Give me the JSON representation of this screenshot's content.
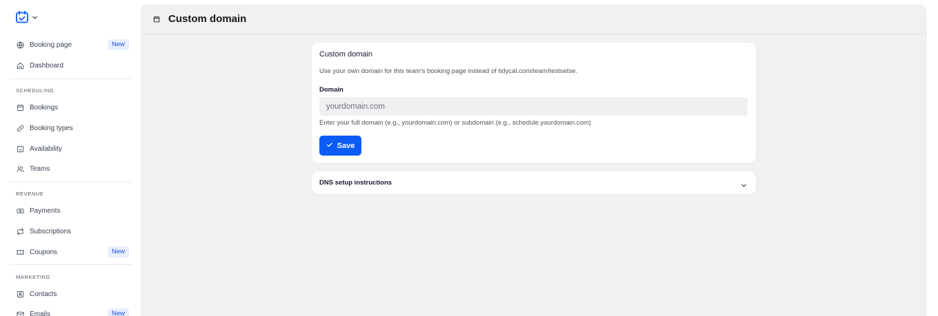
{
  "sidebar": {
    "logo_icon": "calendar-check-icon",
    "logo_chevron_icon": "chevron-down-icon",
    "items_top": [
      {
        "label": "Booking page",
        "icon": "globe-icon",
        "badge": "New"
      },
      {
        "label": "Dashboard",
        "icon": "home-icon"
      }
    ],
    "sections": [
      {
        "label": "SCHEDULING",
        "items": [
          {
            "label": "Bookings",
            "icon": "calendar-icon"
          },
          {
            "label": "Booking types",
            "icon": "link-icon"
          },
          {
            "label": "Availability",
            "icon": "calendar-check-icon"
          },
          {
            "label": "Teams",
            "icon": "users-icon"
          }
        ]
      },
      {
        "label": "REVENUE",
        "items": [
          {
            "label": "Payments",
            "icon": "banknote-icon"
          },
          {
            "label": "Subscriptions",
            "icon": "repeat-icon"
          },
          {
            "label": "Coupons",
            "icon": "ticket-icon",
            "badge": "New"
          }
        ]
      },
      {
        "label": "MARKETING",
        "items": [
          {
            "label": "Contacts",
            "icon": "contact-icon"
          },
          {
            "label": "Emails",
            "icon": "mail-icon",
            "badge": "New"
          }
        ]
      }
    ]
  },
  "header": {
    "icon": "calendar-icon",
    "title": "Custom domain"
  },
  "custom_domain_card": {
    "title": "Custom domain",
    "description": "Use your own domain for this team's booking page instead of tidycal.com/team/testsetse.",
    "field_label": "Domain",
    "field_value": "",
    "field_placeholder": "yourdomain.com",
    "help_text": "Enter your full domain (e.g., yourdomain.com) or subdomain (e.g., schedule.yourdomain.com)",
    "save_label": "Save",
    "save_icon": "check-icon"
  },
  "dns_card": {
    "title": "DNS setup instructions",
    "icon": "chevron-down-icon"
  },
  "colors": {
    "accent": "#0a5cf5",
    "badge_bg": "#e7efff",
    "badge_text": "#1d4ed8",
    "main_bg": "#f1f1f3"
  }
}
